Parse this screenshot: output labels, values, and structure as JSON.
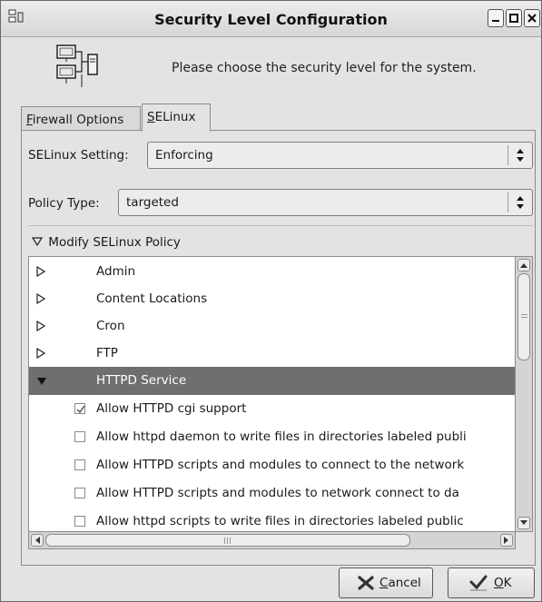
{
  "window": {
    "title": "Security Level Configuration",
    "header_text": "Please choose the security level for the system."
  },
  "tabs": [
    {
      "label_mnemonic": "F",
      "label_rest": "irewall Options",
      "selected": false
    },
    {
      "label_mnemonic": "S",
      "label_rest": "ELinux",
      "selected": true
    }
  ],
  "selinux": {
    "setting_label": "SELinux Setting:",
    "setting_value": "Enforcing",
    "policy_label": "Policy Type:",
    "policy_value": "targeted",
    "modify_label": "Modify SELinux Policy"
  },
  "tree": {
    "categories": [
      {
        "label": "Admin",
        "expanded": false
      },
      {
        "label": "Content Locations",
        "expanded": false
      },
      {
        "label": "Cron",
        "expanded": false
      },
      {
        "label": "FTP",
        "expanded": false
      },
      {
        "label": "HTTPD Service",
        "expanded": true,
        "selected": true
      }
    ],
    "options": [
      {
        "label": "Allow HTTPD cgi support",
        "checked": true
      },
      {
        "label": "Allow httpd daemon to write files in directories labeled publi",
        "checked": false
      },
      {
        "label": "Allow HTTPD scripts and modules to connect to the network",
        "checked": false
      },
      {
        "label": "Allow HTTPD scripts and modules to network connect to da",
        "checked": false
      },
      {
        "label": "Allow httpd scripts to write files in directories labeled public",
        "checked": false
      }
    ]
  },
  "buttons": {
    "cancel_mnemonic": "C",
    "cancel_rest": "ancel",
    "ok_mnemonic": "O",
    "ok_rest": "K"
  },
  "icons": {
    "window_menu": "computer-icon",
    "header": "network-computers-icon",
    "cancel": "x-icon",
    "ok": "check-icon"
  }
}
